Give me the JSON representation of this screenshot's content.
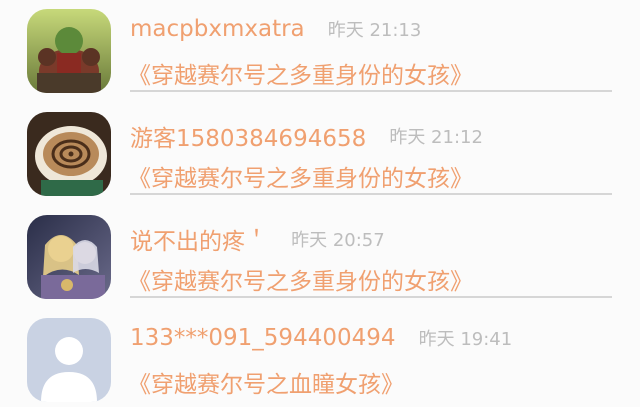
{
  "comments": [
    {
      "username": "macpbxmxatra",
      "time": "昨天 21:13",
      "book": "《穿越赛尔号之多重身份的女孩》",
      "avatar_icon": "orc-warrior-avatar"
    },
    {
      "username": "游客1580384694658",
      "time": "昨天 21:12",
      "book": "《穿越赛尔号之多重身份的女孩》",
      "avatar_icon": "coffee-cup-avatar"
    },
    {
      "username": "说不出的疼＇",
      "time": "昨天 20:57",
      "book": "《穿越赛尔号之多重身份的女孩》",
      "avatar_icon": "anime-couple-avatar"
    },
    {
      "username": "133***091_594400494",
      "time": "昨天 19:41",
      "book": "《穿越赛尔号之血瞳女孩》",
      "avatar_icon": "default-user-avatar"
    }
  ],
  "colors": {
    "username": "#f0a070",
    "book_title": "#f0a070",
    "timestamp": "#bdbdbd",
    "divider": "#d6d6d6",
    "background": "#fbfbfb"
  }
}
